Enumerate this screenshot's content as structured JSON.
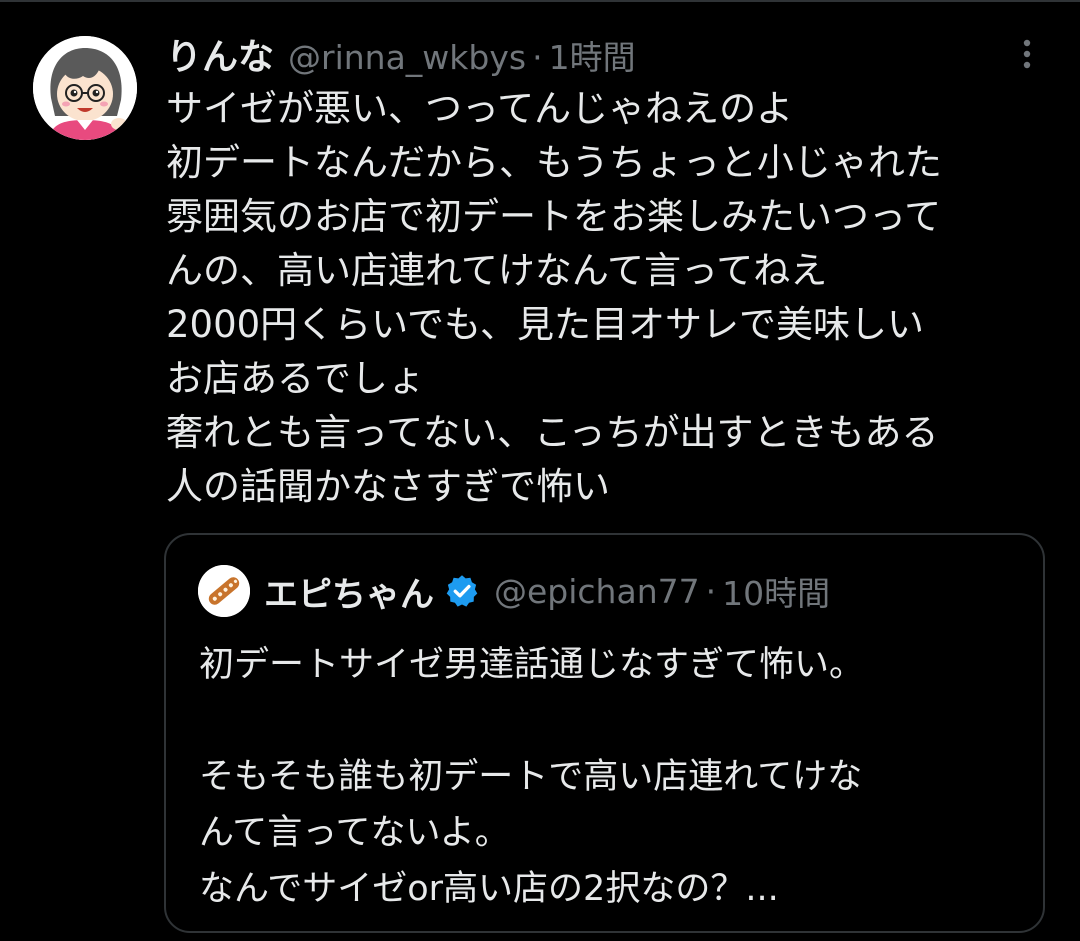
{
  "tweet": {
    "author": {
      "display_name": "りんな",
      "handle": "@rinna_wkbys",
      "avatar_icon": "cartoon-girl-avatar-icon"
    },
    "separator": "·",
    "time": "1時間",
    "more_icon": "more-vertical-icon",
    "lines": [
      "サイゼが悪い、つってんじゃねえのよ",
      "初デートなんだから、もうちょっと小じゃれた",
      "雰囲気のお店で初デートをお楽しみたいつって",
      "んの、高い店連れてけなんて言ってねえ",
      "2000円くらいでも、見た目オサレで美味しい",
      "お店あるでしょ",
      "奢れとも言ってない、こっちが出すときもある",
      "人の話聞かなさすぎで怖い"
    ]
  },
  "quote": {
    "author": {
      "display_name": "エピちゃん",
      "handle": "@epichan77",
      "avatar_icon": "pretzel-avatar-icon",
      "verified_icon": "verified-badge-icon"
    },
    "separator": "·",
    "time": "10時間",
    "lines": [
      "初デートサイゼ男達話通じなすぎて怖い。",
      "",
      "そもそも誰も初デートで高い店連れてけな",
      "んて言ってないよ。",
      "なんでサイゼor高い店の2択なの？..."
    ]
  },
  "colors": {
    "background": "#000000",
    "primary_text": "#e7e9ea",
    "secondary_text": "#71767b",
    "border": "#2f3336",
    "verified": "#1d9bf0"
  }
}
